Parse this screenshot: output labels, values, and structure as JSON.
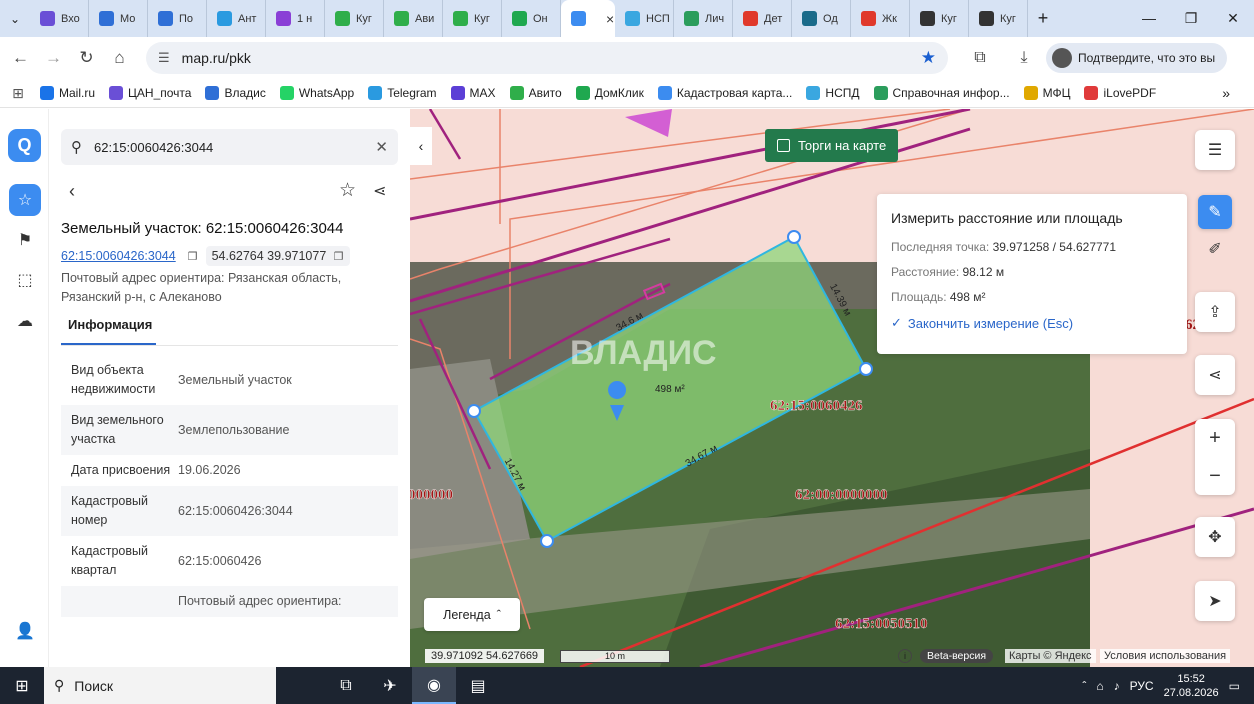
{
  "browser": {
    "tabs": [
      {
        "label": "Вхо",
        "color": "#6a4fd6"
      },
      {
        "label": "Мо",
        "color": "#2f6fd6"
      },
      {
        "label": "По",
        "color": "#2f6fd6"
      },
      {
        "label": "Ант",
        "color": "#2a9ae0"
      },
      {
        "label": "1 н",
        "color": "#8a3fd6"
      },
      {
        "label": "Куг",
        "color": "#2fae4a"
      },
      {
        "label": "Ави",
        "color": "#2fae4a"
      },
      {
        "label": "Куг",
        "color": "#2fae4a"
      },
      {
        "label": "Он",
        "color": "#1fa84f"
      },
      {
        "label": "",
        "color": "#3c8cf0",
        "active": true
      },
      {
        "label": "НСП",
        "color": "#3aa7e0"
      },
      {
        "label": "Лич",
        "color": "#2b9d5c"
      },
      {
        "label": "Дет",
        "color": "#e0392b"
      },
      {
        "label": "Од",
        "color": "#1a6b8a"
      },
      {
        "label": "Жк",
        "color": "#e0392b"
      },
      {
        "label": "Куг",
        "color": "#333333"
      },
      {
        "label": "Куг",
        "color": "#333333"
      }
    ],
    "url": "map.ru/pkk",
    "profile_label": "Подтвердите, что это вы",
    "bookmarks": [
      {
        "label": "Mail.ru",
        "color": "#1a73e8"
      },
      {
        "label": "ЦАН_почта",
        "color": "#6a4fd6"
      },
      {
        "label": "Владис",
        "color": "#2f6fd6"
      },
      {
        "label": "WhatsApp",
        "color": "#25d366"
      },
      {
        "label": "Telegram",
        "color": "#2a9ae0"
      },
      {
        "label": "MAX",
        "color": "#5b3fd6"
      },
      {
        "label": "Авито",
        "color": "#2fae4a"
      },
      {
        "label": "ДомКлик",
        "color": "#1fa84f"
      },
      {
        "label": "Кадастровая карта...",
        "color": "#3c8cf0"
      },
      {
        "label": "НСПД",
        "color": "#3aa7e0"
      },
      {
        "label": "Справочная инфор...",
        "color": "#2b9d5c"
      },
      {
        "label": "МФЦ",
        "color": "#e0a800"
      },
      {
        "label": "iLovePDF",
        "color": "#e03a3a"
      }
    ]
  },
  "sidebar": {
    "search_value": "62:15:0060426:3044",
    "title": "Земельный участок: 62:15:0060426:3044",
    "cadastral_link": "62:15:0060426:3044",
    "coords": "54.62764 39.971077",
    "address": "Почтовый адрес ориентира: Рязанская область, Рязанский р-н, с Алеканово",
    "tab_label": "Информация",
    "info_rows": [
      {
        "key": "Вид объекта недвижимости",
        "value": "Земельный участок"
      },
      {
        "key": "Вид земельного участка",
        "value": "Землепользование"
      },
      {
        "key": "Дата присвоения",
        "value": "19.06.2026"
      },
      {
        "key": "Кадастровый номер",
        "value": "62:15:0060426:3044"
      },
      {
        "key": "Кадастровый квартал",
        "value": "62:15:0060426"
      },
      {
        "key": "",
        "value": "Почтовый адрес ориентира:"
      }
    ]
  },
  "map": {
    "torgi_label": "Торги на карте",
    "measure": {
      "title": "Измерить расстояние или площадь",
      "last_point_label": "Последняя точка:",
      "last_point_value": "39.971258 / 54.627771",
      "distance_label": "Расстояние:",
      "distance_value": "98.12 м",
      "area_label": "Площадь:",
      "area_value": "498 м²",
      "finish": "Закончить измерение (Esc)"
    },
    "labels": {
      "q1": "62:15:0060426",
      "q2": "62:00:0000000",
      "q3": "62:15:0050510",
      "q4": "000000",
      "q5": "62:00",
      "area": "498 м²",
      "edge_top": "34.6 м",
      "edge_right": "14.39 м",
      "edge_bottom": "34.67 м",
      "edge_left": "14.27 м",
      "watermark": "ВЛАДИС"
    },
    "legend_label": "Легенда",
    "footer_coords": "39.971092  54.627669",
    "scale": "10 m",
    "beta": "Beta-версия",
    "copyright": "Карты © Яндекс",
    "terms": "Условия использования"
  },
  "taskbar": {
    "search_label": "Поиск",
    "lang": "РУС",
    "time": "15:52",
    "date": "27.08.2026"
  }
}
